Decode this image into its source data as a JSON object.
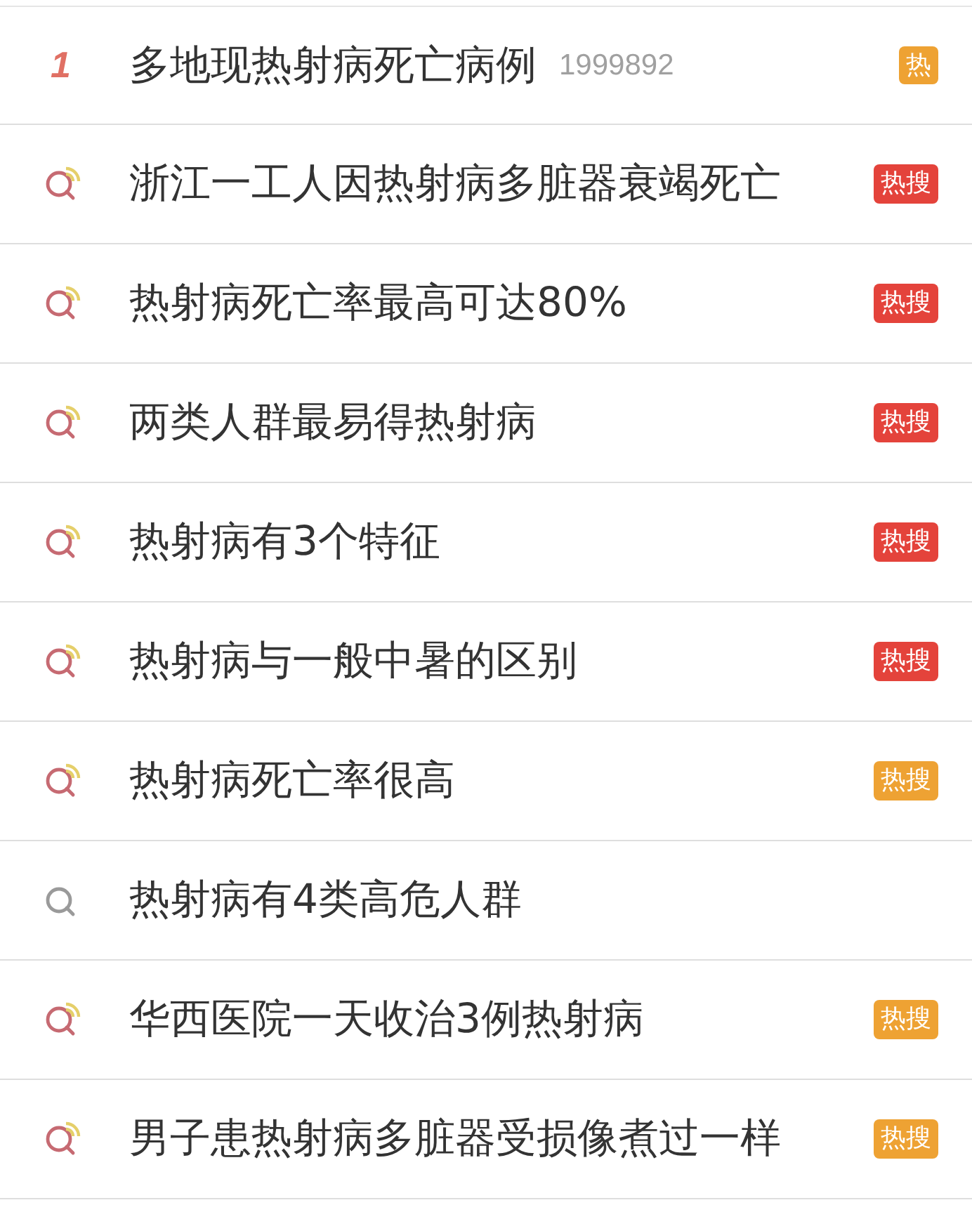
{
  "items": [
    {
      "kind": "rank",
      "rank": "1",
      "title": "多地现热射病死亡病例",
      "count": "1999892",
      "badge": {
        "label": "热",
        "color": "#eea233"
      }
    },
    {
      "kind": "hot-search",
      "title": "浙江一工人因热射病多脏器衰竭死亡",
      "badge": {
        "label": "热搜",
        "color": "#e4433b"
      }
    },
    {
      "kind": "hot-search",
      "title": "热射病死亡率最高可达80%",
      "badge": {
        "label": "热搜",
        "color": "#e4433b"
      }
    },
    {
      "kind": "hot-search",
      "title": "两类人群最易得热射病",
      "badge": {
        "label": "热搜",
        "color": "#e4433b"
      }
    },
    {
      "kind": "hot-search",
      "title": "热射病有3个特征",
      "badge": {
        "label": "热搜",
        "color": "#e4433b"
      }
    },
    {
      "kind": "hot-search",
      "title": "热射病与一般中暑的区别",
      "badge": {
        "label": "热搜",
        "color": "#e4433b"
      }
    },
    {
      "kind": "hot-search",
      "title": "热射病死亡率很高",
      "badge": {
        "label": "热搜",
        "color": "#eea233"
      }
    },
    {
      "kind": "search",
      "title": "热射病有4类高危人群"
    },
    {
      "kind": "hot-search",
      "title": "华西医院一天收治3例热射病",
      "badge": {
        "label": "热搜",
        "color": "#eea233"
      }
    },
    {
      "kind": "hot-search",
      "title": "男子患热射病多脏器受损像煮过一样",
      "badge": {
        "label": "热搜",
        "color": "#eea233"
      }
    }
  ]
}
